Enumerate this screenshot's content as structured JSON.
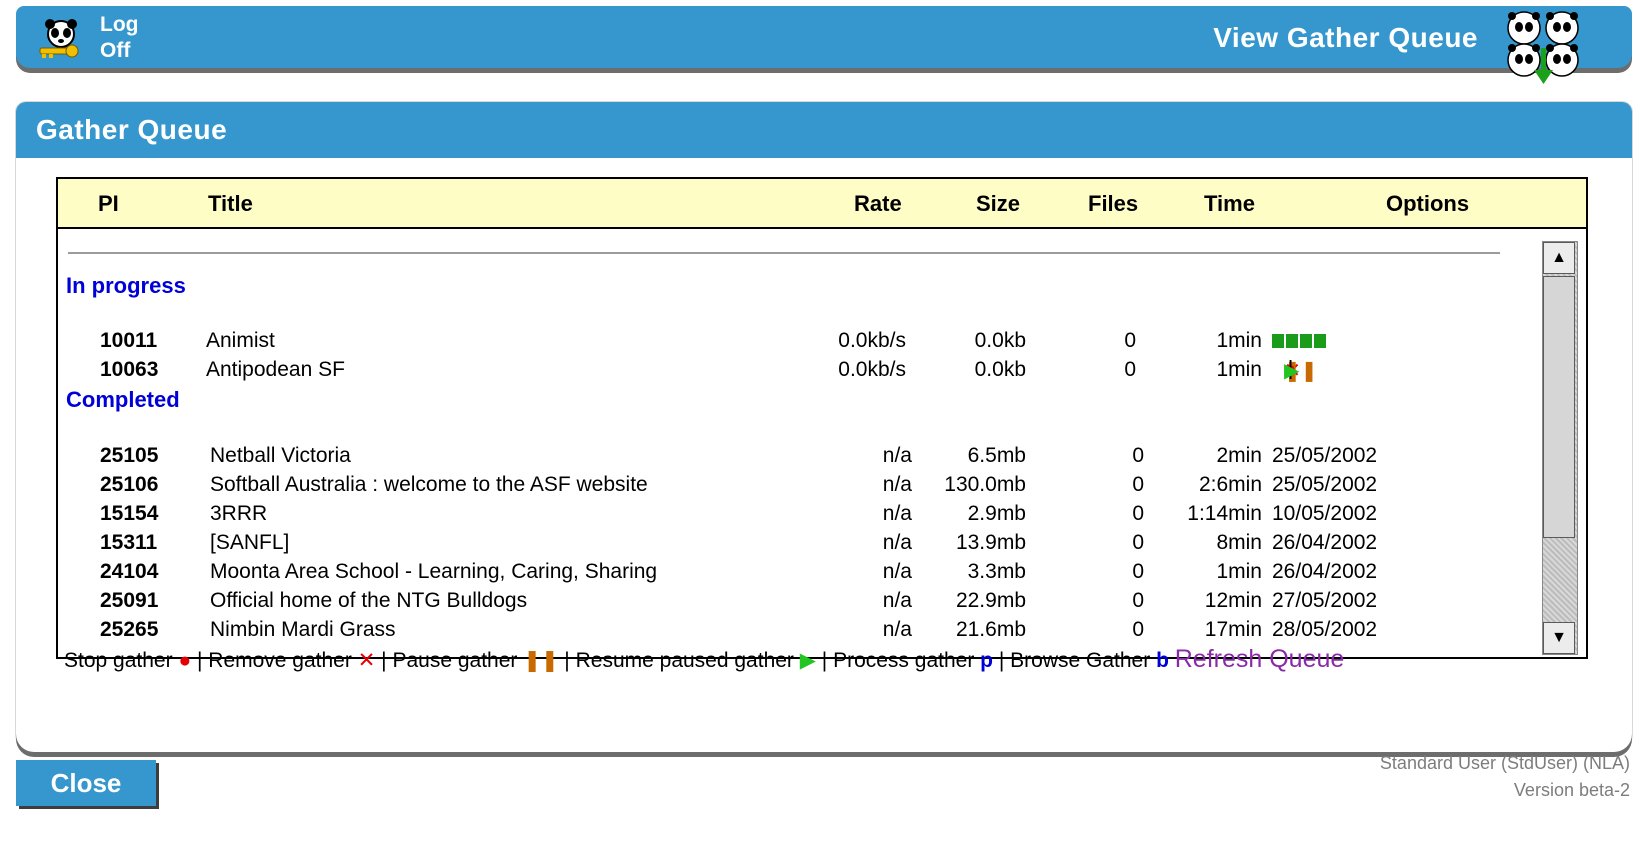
{
  "banner": {
    "logoff_line1": "Log",
    "logoff_line2": "Off",
    "title": "View Gather Queue"
  },
  "panel": {
    "title": "Gather Queue"
  },
  "table": {
    "headers": {
      "pi": "PI",
      "title": "Title",
      "rate": "Rate",
      "size": "Size",
      "files": "Files",
      "time": "Time",
      "options": "Options"
    },
    "in_progress_label": "In progress",
    "completed_label": "Completed",
    "in_progress": [
      {
        "pi": "10011",
        "title": "Animist",
        "rate": "0.0kb/s",
        "size": "0.0kb",
        "files": "0",
        "time": "1min",
        "status": "progress"
      },
      {
        "pi": "10063",
        "title": "Antipodean SF",
        "rate": "0.0kb/s",
        "size": "0.0kb",
        "files": "0",
        "time": "1min",
        "status": "controls"
      }
    ],
    "completed": [
      {
        "pi": "25105",
        "title": "Netball Victoria",
        "rate": "n/a",
        "size": "6.5mb",
        "files": "0",
        "time": "2min",
        "date": "25/05/2002"
      },
      {
        "pi": "25106",
        "title": "Softball Australia : welcome to the ASF website",
        "rate": "n/a",
        "size": "130.0mb",
        "files": "0",
        "time": "2:6min",
        "date": "25/05/2002"
      },
      {
        "pi": "15154",
        "title": "3RRR",
        "rate": "n/a",
        "size": "2.9mb",
        "files": "0",
        "time": "1:14min",
        "date": "10/05/2002"
      },
      {
        "pi": "15311",
        "title": "[SANFL]",
        "rate": "n/a",
        "size": "13.9mb",
        "files": "0",
        "time": "8min",
        "date": "26/04/2002"
      },
      {
        "pi": "24104",
        "title": "Moonta Area School - Learning, Caring, Sharing",
        "rate": "n/a",
        "size": "3.3mb",
        "files": "0",
        "time": "1min",
        "date": "26/04/2002"
      },
      {
        "pi": "25091",
        "title": "Official home of the NTG Bulldogs",
        "rate": "n/a",
        "size": "22.9mb",
        "files": "0",
        "time": "12min",
        "date": "27/05/2002"
      },
      {
        "pi": "25265",
        "title": "Nimbin Mardi Grass",
        "rate": "n/a",
        "size": "21.6mb",
        "files": "0",
        "time": "17min",
        "date": "28/05/2002"
      }
    ]
  },
  "legend": {
    "stop": "Stop gather",
    "remove": "Remove gather",
    "pause": "Pause gather",
    "resume": "Resume paused gather",
    "process": "Process gather",
    "process_key": "p",
    "browse": "Browse Gather",
    "browse_key": "b",
    "separator": "|",
    "refresh": "Refresh Queue"
  },
  "footer": {
    "close_label": "Close",
    "user": "Standard User (StdUser) (NLA)",
    "version": "Version beta-2"
  },
  "colors": {
    "banner_blue": "#3597cd",
    "header_yellow": "#fffdc6",
    "section_blue": "#0000d8",
    "refresh_purple": "#8a2aa8",
    "stop_red": "#e40000",
    "pause_orange": "#c86a00",
    "play_green": "#22c522",
    "progress_green": "#1a9b1a"
  }
}
